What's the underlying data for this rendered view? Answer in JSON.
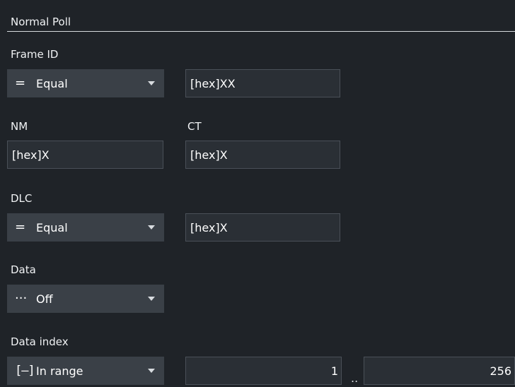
{
  "section": {
    "title": "Normal Poll"
  },
  "frame_id": {
    "label": "Frame ID",
    "operator": {
      "icon": "equals-icon",
      "glyph": "=",
      "value": "Equal"
    },
    "value": "[hex]XX"
  },
  "nm": {
    "label": "NM",
    "value": "[hex]X"
  },
  "ct": {
    "label": "CT",
    "value": "[hex]X"
  },
  "dlc": {
    "label": "DLC",
    "operator": {
      "icon": "equals-icon",
      "glyph": "=",
      "value": "Equal"
    },
    "value": "[hex]X"
  },
  "data": {
    "label": "Data",
    "operator": {
      "icon": "ellipsis-icon",
      "glyph": "···",
      "value": "Off"
    }
  },
  "data_index": {
    "label": "Data index",
    "operator": {
      "icon": "range-bracket-icon",
      "glyph": "[–]",
      "value": "In range"
    },
    "from": "1",
    "separator": "..",
    "to": "256"
  }
}
